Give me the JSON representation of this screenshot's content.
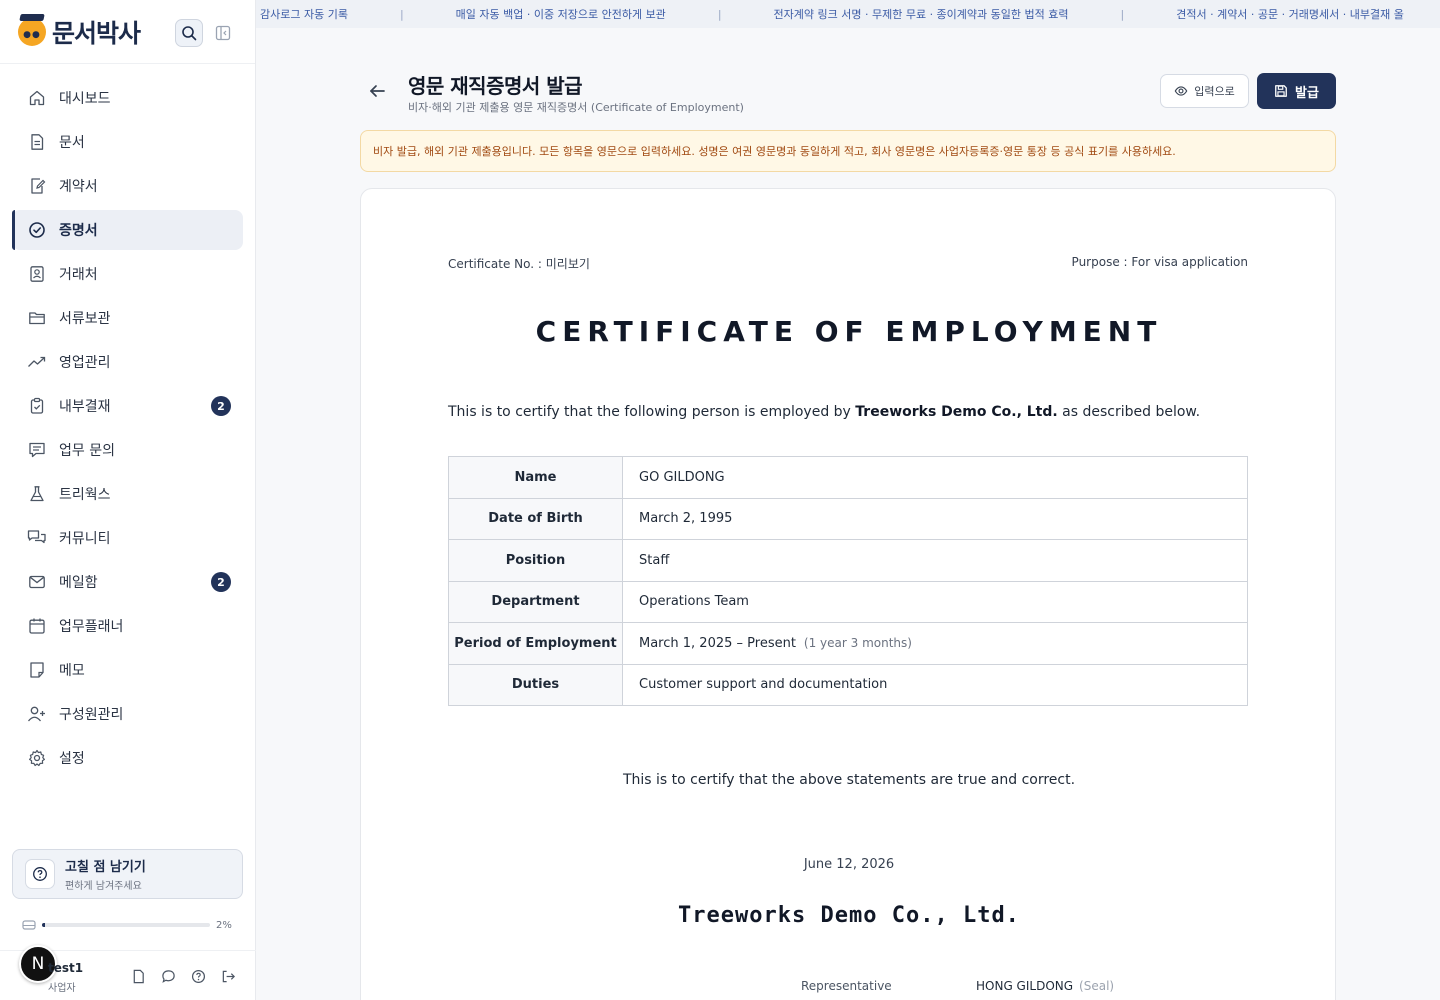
{
  "brand": {
    "name": "문서박사"
  },
  "ticker": [
    "감사로그 자동 기록",
    "매일 자동 백업 · 이중 저장으로 안전하게 보관",
    "전자계약 링크 서명 · 무제한 무료 · 종이계약과 동일한 법적 효력",
    "견적서 · 계약서 · 공문 · 거래명세서 · 내부결재 올"
  ],
  "ticker_separator": "|",
  "sidebar": {
    "items": [
      {
        "label": "대시보드",
        "icon": "home-icon"
      },
      {
        "label": "문서",
        "icon": "document-icon"
      },
      {
        "label": "계약서",
        "icon": "contract-edit-icon"
      },
      {
        "label": "증명서",
        "icon": "check-circle-icon",
        "active": true
      },
      {
        "label": "거래처",
        "icon": "contact-card-icon"
      },
      {
        "label": "서류보관",
        "icon": "folder-icon"
      },
      {
        "label": "영업관리",
        "icon": "trend-up-icon"
      },
      {
        "label": "내부결재",
        "icon": "clipboard-check-icon",
        "badge": "2"
      },
      {
        "label": "업무 문의",
        "icon": "message-lines-icon"
      },
      {
        "label": "트리웍스",
        "icon": "flask-icon"
      },
      {
        "label": "커뮤니티",
        "icon": "chat-bubbles-icon"
      },
      {
        "label": "메일함",
        "icon": "mail-icon",
        "badge": "2"
      },
      {
        "label": "업무플래너",
        "icon": "calendar-icon"
      },
      {
        "label": "메모",
        "icon": "note-icon"
      },
      {
        "label": "구성원관리",
        "icon": "user-plus-icon"
      },
      {
        "label": "설정",
        "icon": "gear-icon"
      }
    ],
    "feedback": {
      "title": "고칠 점 남기기",
      "subtitle": "편하게 남겨주세요"
    },
    "storage": {
      "percent_label": "2%",
      "fraction": 0.02
    },
    "user": {
      "avatar_letter": "N",
      "name": "test1",
      "role": "사업자"
    }
  },
  "header": {
    "title": "영문 재직증명서 발급",
    "subtitle": "비자·해외 기관 제출용 영문 재직증명서 (Certificate of Employment)",
    "input_button": "입력으로",
    "issue_button": "발급"
  },
  "notice": "비자 발급, 해외 기관 제출용입니다. 모든 항목을 영문으로 입력하세요. 성명은 여권 영문명과 동일하게 적고, 회사 영문명은 사업자등록증·영문 통장 등 공식 표기를 사용하세요.",
  "certificate": {
    "number": "Certificate No. : 미리보기",
    "purpose": "Purpose : For visa application",
    "title": "CERTIFICATE OF EMPLOYMENT",
    "intro_before": "This is to certify that the following person is employed by ",
    "company_inline": "Treeworks Demo Co., Ltd.",
    "intro_after": " as described below.",
    "rows": [
      {
        "label": "Name",
        "value": "GO GILDONG",
        "note": ""
      },
      {
        "label": "Date of Birth",
        "value": "March 2, 1995",
        "note": ""
      },
      {
        "label": "Position",
        "value": "Staff",
        "note": ""
      },
      {
        "label": "Department",
        "value": "Operations Team",
        "note": ""
      },
      {
        "label": "Period of Employment",
        "value": "March 1, 2025 – Present",
        "note": "(1 year 3 months)"
      },
      {
        "label": "Duties",
        "value": "Customer support and documentation",
        "note": ""
      }
    ],
    "certify_statement": "This is to certify that the above statements are true and correct.",
    "date": "June 12, 2026",
    "company": "Treeworks Demo Co., Ltd.",
    "representative_label": "Representative",
    "representative_name": "HONG GILDONG",
    "seal": "(Seal)"
  },
  "colors": {
    "brand_navy": "#22335a",
    "notice_bg": "#fff8e6",
    "notice_text": "#a14a12",
    "ticker_text": "#3b5ba5"
  }
}
